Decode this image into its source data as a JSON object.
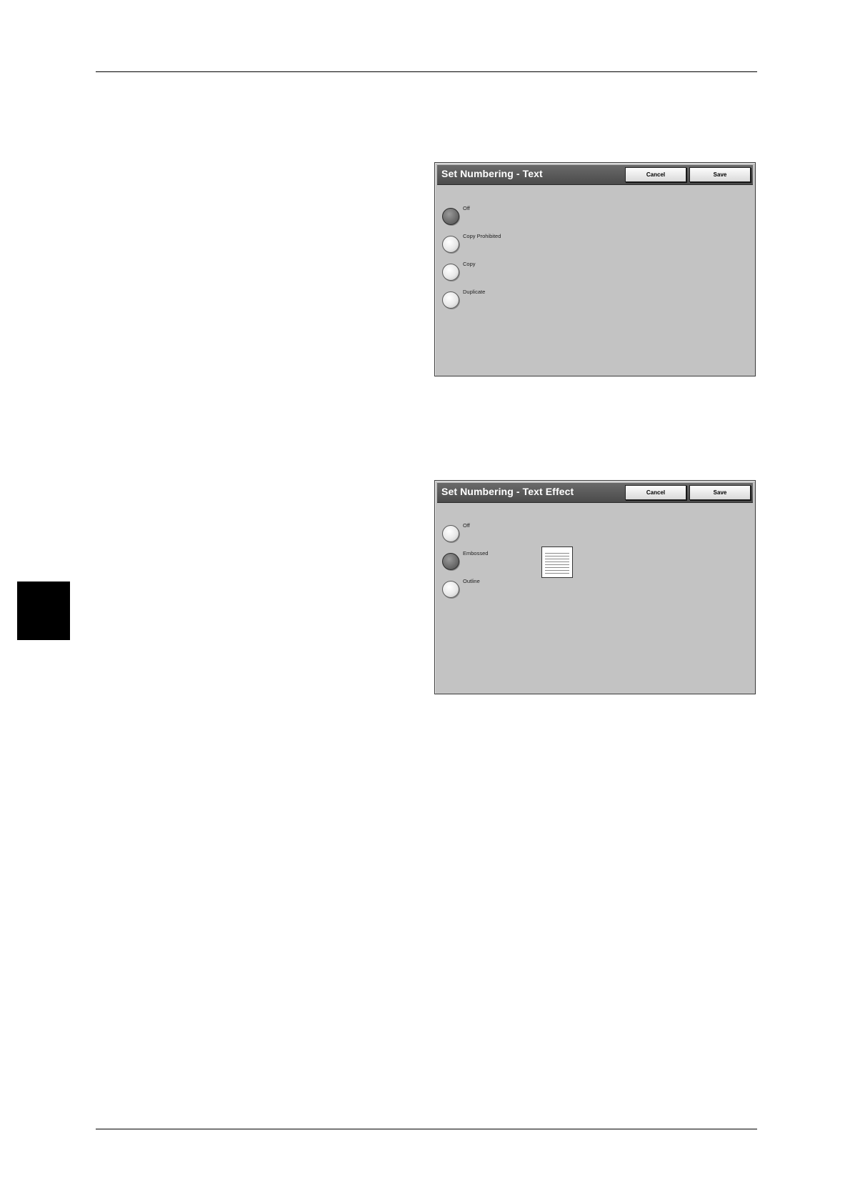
{
  "panels": {
    "text": {
      "title": "Set Numbering - Text",
      "cancel_label": "Cancel",
      "save_label": "Save",
      "options": [
        "Off",
        "Copy Prohibited",
        "Copy",
        "Duplicate"
      ],
      "selected": "Off"
    },
    "text_effect": {
      "title": "Set Numbering - Text Effect",
      "cancel_label": "Cancel",
      "save_label": "Save",
      "options": [
        "Off",
        "Embossed",
        "Outline"
      ],
      "selected": "Embossed"
    }
  },
  "icons": {
    "effect_preview": "embossed-text-preview-icon"
  },
  "colors": {
    "panel_bg": "#c3c3c3",
    "titlebar_bg": "#555555",
    "title_text": "#ffffff",
    "side_tab": "#000000"
  }
}
